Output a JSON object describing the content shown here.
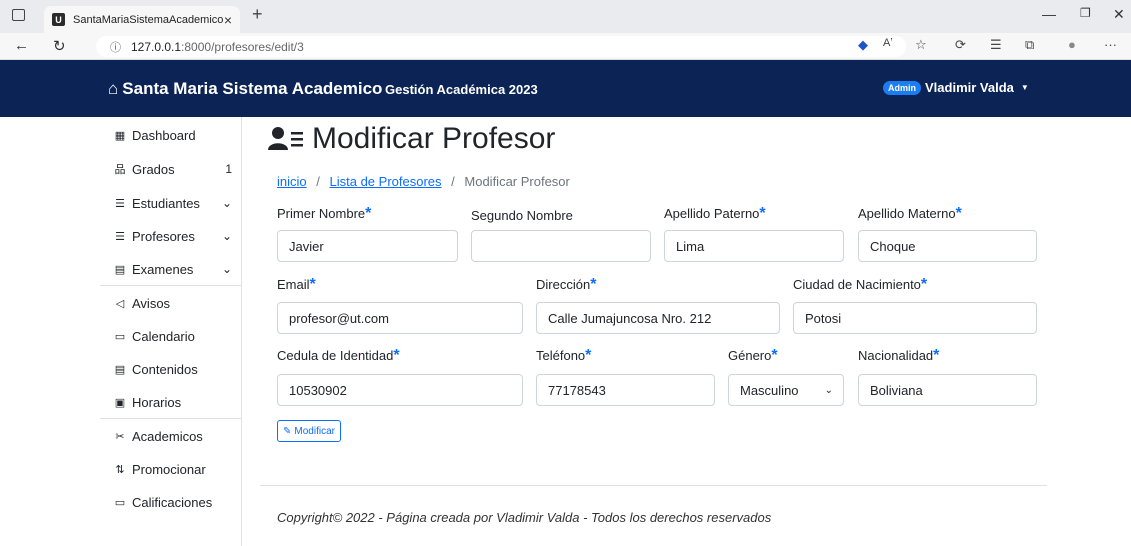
{
  "browser": {
    "tab_title": "SantaMariaSistemaAcademico",
    "favicon_letter": "U",
    "url_host": "127.0.0.1",
    "url_path": ":8000/profesores/edit/3"
  },
  "navbar": {
    "brand": "Santa Maria Sistema Academico",
    "subtitle": "Gestión Académica 2023",
    "badge": "Admin",
    "user": "Vladimir Valda"
  },
  "sidebar": {
    "items": [
      {
        "label": "Dashboard",
        "icon": "grid-icon"
      },
      {
        "label": "Grados",
        "icon": "sitemap-icon",
        "count": "1"
      },
      {
        "label": "Estudiantes",
        "icon": "user-list-icon"
      },
      {
        "label": "Profesores",
        "icon": "user-list-icon"
      },
      {
        "label": "Examenes",
        "icon": "document-icon"
      },
      {
        "label": "Avisos",
        "icon": "megaphone-icon"
      },
      {
        "label": "Calendario",
        "icon": "calendar-icon"
      },
      {
        "label": "Contenidos",
        "icon": "content-icon"
      },
      {
        "label": "Horarios",
        "icon": "schedule-icon"
      },
      {
        "label": "Academicos",
        "icon": "tools-icon"
      },
      {
        "label": "Promocionar",
        "icon": "arrows-updown-icon"
      },
      {
        "label": "Calificaciones",
        "icon": "card-icon"
      }
    ]
  },
  "page": {
    "title": "Modificar Profesor",
    "breadcrumb": {
      "home": "inicio",
      "list": "Lista de Profesores",
      "current": "Modificar Profesor",
      "sep": "/"
    }
  },
  "form": {
    "required_mark": "*",
    "primer_nombre": {
      "label": "Primer Nombre",
      "value": "Javier"
    },
    "segundo_nombre": {
      "label": "Segundo Nombre",
      "value": ""
    },
    "apellido_paterno": {
      "label": "Apellido Paterno",
      "value": "Lima"
    },
    "apellido_materno": {
      "label": "Apellido Materno",
      "value": "Choque"
    },
    "email": {
      "label": "Email",
      "value": "profesor@ut.com"
    },
    "direccion": {
      "label": "Dirección",
      "value": "Calle Jumajuncosa Nro. 212"
    },
    "ciudad": {
      "label": "Ciudad de Nacimiento",
      "value": "Potosi"
    },
    "ci": {
      "label": "Cedula de Identidad",
      "value": "10530902"
    },
    "telefono": {
      "label": "Teléfono",
      "value": "77178543"
    },
    "genero": {
      "label": "Género",
      "value": "Masculino"
    },
    "nacionalidad": {
      "label": "Nacionalidad",
      "value": "Boliviana"
    },
    "submit": "Modificar"
  },
  "footer": {
    "text": "Copyright© 2022 - Página creada por Vladimir Valda - Todos los derechos reservados"
  },
  "colors": {
    "navbar": "#0b2455",
    "accent": "#0d6efd",
    "badge": "#1c7cf2"
  }
}
